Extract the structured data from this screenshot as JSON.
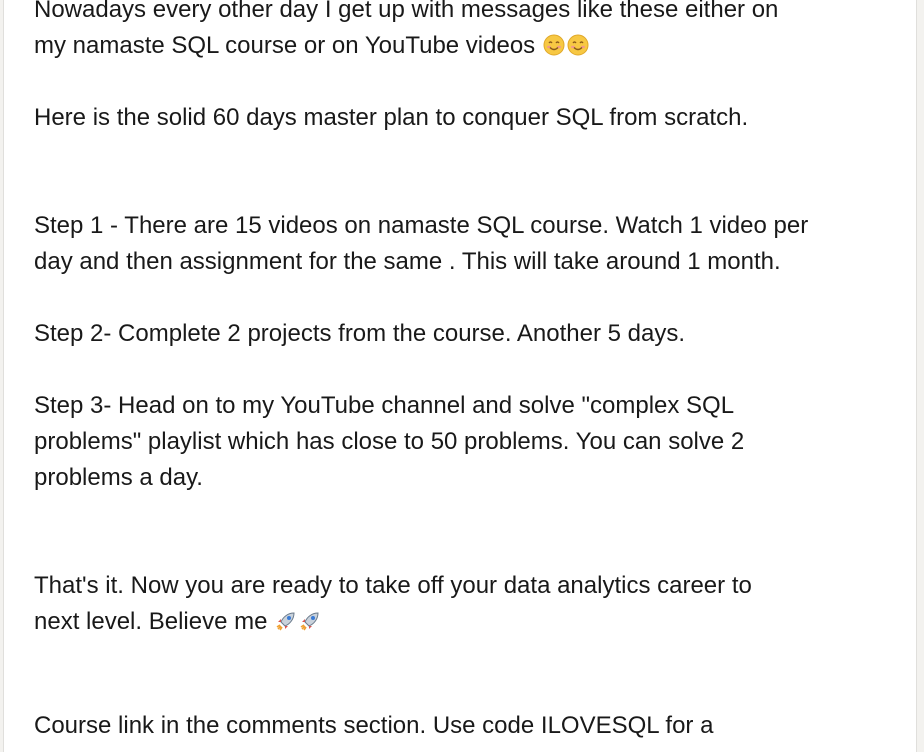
{
  "post": {
    "lines": {
      "l1": "Nowadays every other day I get up with messages like these either on",
      "l2": "my namaste SQL course or on YouTube videos",
      "l3": "Here is the solid 60 days master plan to conquer SQL from scratch.",
      "l4": "Step 1 - There are 15 videos on namaste SQL course. Watch 1 video per",
      "l5": "day and then assignment for the same . This will take around 1 month.",
      "l6": "Step 2- Complete 2 projects from the course. Another 5 days.",
      "l7": "Step 3- Head on to my YouTube channel and solve \"complex SQL",
      "l8": "problems\" playlist which has close to 50 problems. You can solve 2",
      "l9": "problems a day.",
      "l10": "That's it. Now you are ready to take off your data analytics career to",
      "l11": "next level. Believe me",
      "l12": "Course link in the comments section. Use code ILOVESQL for a"
    },
    "emojis": {
      "smile": "smiling-face-icon",
      "rocket": "rocket-icon"
    }
  }
}
